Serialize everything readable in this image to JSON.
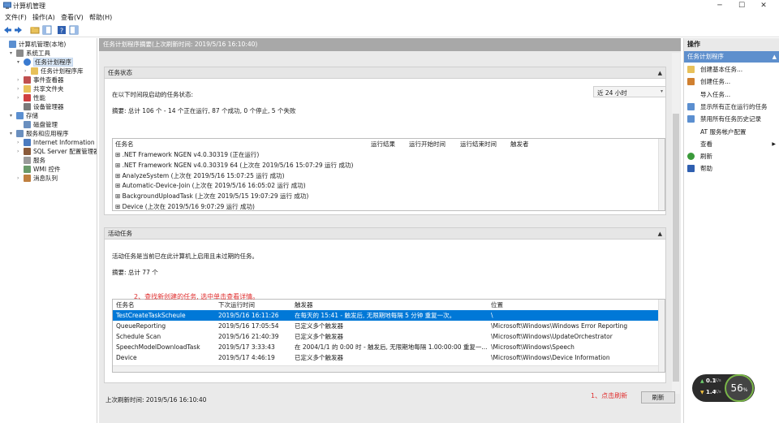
{
  "window": {
    "title": "计算机管理",
    "minimize": "─",
    "maximize": "☐",
    "close": "✕"
  },
  "menu": [
    "文件(F)",
    "操作(A)",
    "查看(V)",
    "帮助(H)"
  ],
  "tree": [
    {
      "label": "计算机管理(本地)",
      "level": 0,
      "expander": "",
      "icon": "computer-icon"
    },
    {
      "label": "系统工具",
      "level": 1,
      "expander": "▾",
      "icon": "tools-icon"
    },
    {
      "label": "任务计划程序",
      "level": 2,
      "expander": "▾",
      "icon": "clock-icon",
      "selected": true
    },
    {
      "label": "任务计划程序库",
      "level": 3,
      "expander": "›",
      "icon": "folder-icon"
    },
    {
      "label": "事件查看器",
      "level": 2,
      "expander": "›",
      "icon": "event-icon"
    },
    {
      "label": "共享文件夹",
      "level": 2,
      "expander": "›",
      "icon": "share-icon"
    },
    {
      "label": "性能",
      "level": 2,
      "expander": "›",
      "icon": "perf-icon"
    },
    {
      "label": "设备管理器",
      "level": 2,
      "expander": "",
      "icon": "device-icon"
    },
    {
      "label": "存储",
      "level": 1,
      "expander": "▾",
      "icon": "storage-icon"
    },
    {
      "label": "磁盘管理",
      "level": 2,
      "expander": "",
      "icon": "disk-icon"
    },
    {
      "label": "服务和应用程序",
      "level": 1,
      "expander": "▾",
      "icon": "apps-icon"
    },
    {
      "label": "Internet Information Se",
      "level": 2,
      "expander": "›",
      "icon": "iis-icon"
    },
    {
      "label": "SQL Server 配置管理器",
      "level": 2,
      "expander": "›",
      "icon": "sql-icon"
    },
    {
      "label": "服务",
      "level": 2,
      "expander": "",
      "icon": "services-icon"
    },
    {
      "label": "WMI 控件",
      "level": 2,
      "expander": "",
      "icon": "wmi-icon"
    },
    {
      "label": "消息队列",
      "level": 2,
      "expander": "›",
      "icon": "queue-icon"
    }
  ],
  "center": {
    "header": "任务计划程序摘要(上次刷新时间: 2019/5/16 16:10:40)",
    "status": {
      "title": "任务状态",
      "prompt": "在以下时间段启动的任务状态:",
      "period": "近 24 小时",
      "summary": "摘要: 总计 106 个 - 14 个正在运行, 87 个成功, 0 个停止, 5 个失败",
      "columns": [
        "任务名",
        "运行结果",
        "运行开始时间",
        "运行结束时间",
        "触发者"
      ],
      "rows": [
        "⊞ .NET Framework NGEN v4.0.30319 (正在运行)",
        "⊞ .NET Framework NGEN v4.0.30319 64 (上次在 2019/5/16 15:07:29 运行 成功)",
        "⊞ AnalyzeSystem (上次在 2019/5/16 15:07:25 运行 成功)",
        "⊞ Automatic-Device-Join (上次在 2019/5/16 16:05:02 运行 成功)",
        "⊞ BackgroundUploadTask (上次在 2019/5/15 19:07:29 运行 成功)",
        "⊞ Device (上次在 2019/5/16 9:07:29 运行 成功)"
      ]
    },
    "active": {
      "title": "活动任务",
      "desc": "活动任务是当前已在此计算机上启用且未过期的任务。",
      "summary": "摘要: 总计 77 个",
      "columns": [
        "任务名",
        "下次运行时间",
        "触发器",
        "位置"
      ],
      "rows": [
        [
          "TestCreateTaskScheule",
          "2019/5/16 16:11:26",
          "在每天的 15:41 - 触发后, 无限期地每隔 5 分钟 重复一次。",
          "\\"
        ],
        [
          "QueueReporting",
          "2019/5/16 17:05:54",
          "已定义多个触发器",
          "\\Microsoft\\Windows\\Windows Error Reporting"
        ],
        [
          "Schedule Scan",
          "2019/5/16 21:40:39",
          "已定义多个触发器",
          "\\Microsoft\\Windows\\UpdateOrchestrator"
        ],
        [
          "SpeechModelDownloadTask",
          "2019/5/17 3:33:43",
          "在 2004/1/1 的 0:00 时 - 触发后, 无限期地每隔 1.00:00:00 重复一...",
          "\\Microsoft\\Windows\\Speech"
        ],
        [
          "Device",
          "2019/5/17 4:46:19",
          "已定义多个触发器",
          "\\Microsoft\\Windows\\Device Information"
        ]
      ]
    },
    "last_refresh": "上次刷新时间: 2019/5/16 16:10:40",
    "refresh_button": "刷新"
  },
  "annotations": {
    "find_task": "2、查找新创建的任务, 选中单击查看详情。",
    "click_refresh": "1、点击刷新"
  },
  "actions": {
    "title": "操作",
    "subtitle": "任务计划程序",
    "items": [
      {
        "label": "创建基本任务...",
        "icon": "basic-task-icon"
      },
      {
        "label": "创建任务...",
        "icon": "create-task-icon"
      },
      {
        "label": "导入任务...",
        "icon": ""
      },
      {
        "label": "显示所有正在运行的任务",
        "icon": "running-tasks-icon"
      },
      {
        "label": "禁用所有任务历史记录",
        "icon": "history-icon"
      },
      {
        "label": "AT 服务帐户配置",
        "icon": ""
      },
      {
        "label": "查看",
        "icon": "",
        "submenu": true
      },
      {
        "label": "刷新",
        "icon": "refresh-icon"
      },
      {
        "label": "帮助",
        "icon": "help-icon"
      }
    ]
  },
  "net_widget": {
    "upload": "0.1",
    "upload_unit": "K/s",
    "download": "1.4",
    "download_unit": "K/s",
    "cpu": "56",
    "cpu_unit": "%"
  }
}
